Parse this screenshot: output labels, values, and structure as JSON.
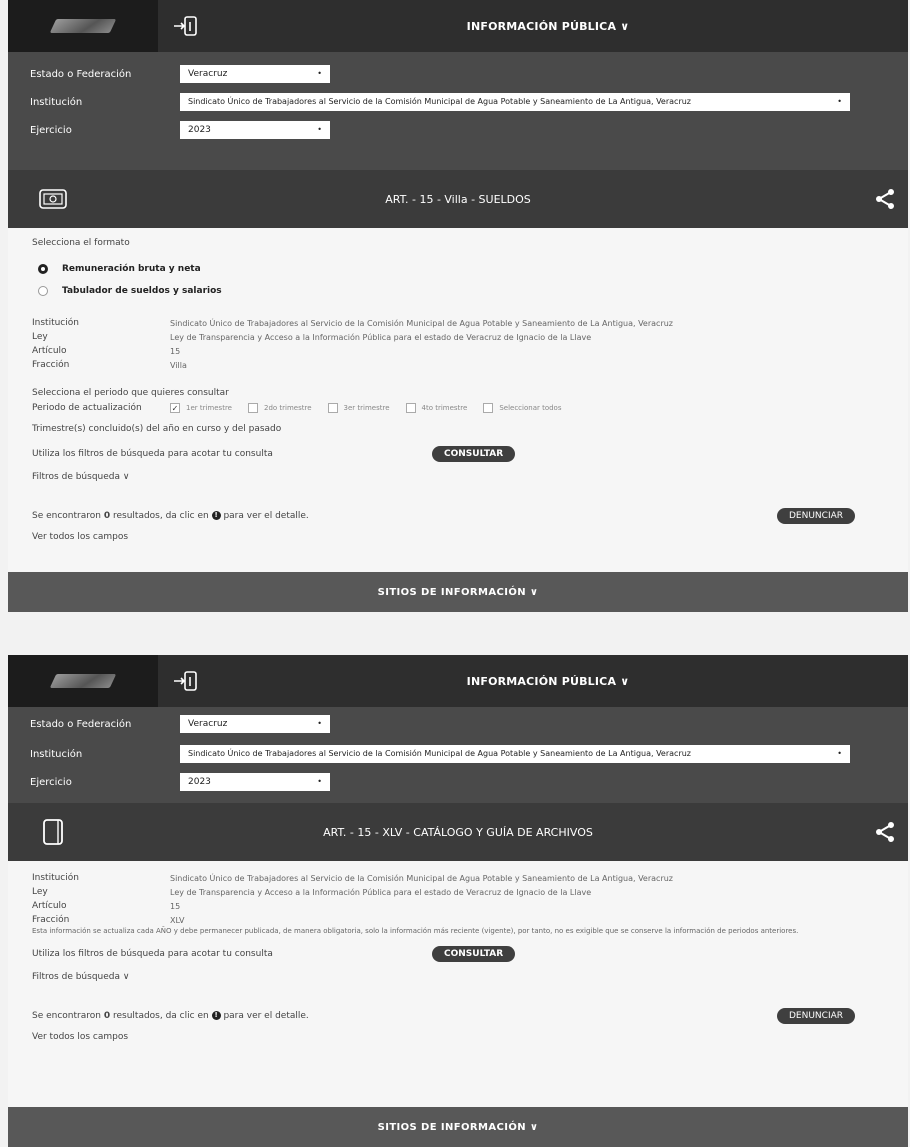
{
  "panel1": {
    "topbar_title": "INFORMACIÓN PÚBLICA ∨",
    "filters": {
      "estado_label": "Estado o Federación",
      "estado_value": "Veracruz",
      "institucion_label": "Institución",
      "institucion_value": "Sindicato Único de Trabajadores al Servicio de la Comisión Municipal de Agua Potable y Saneamiento de La Antigua, Veracruz",
      "ejercicio_label": "Ejercicio",
      "ejercicio_value": "2023"
    },
    "section_title": "ART. - 15 - Villa - SUELDOS",
    "format_label": "Selecciona el formato",
    "format_options": [
      "Remuneración bruta y neta",
      "Tabulador de sueldos y salarios"
    ],
    "details": {
      "institucion_k": "Institución",
      "institucion_v": "Sindicato Único de Trabajadores al Servicio de la Comisión Municipal de Agua Potable y Saneamiento de La Antigua, Veracruz",
      "ley_k": "Ley",
      "ley_v": "Ley de Transparencia y Acceso a la Información Pública para el estado de Veracruz de Ignacio de la Llave",
      "articulo_k": "Artículo",
      "articulo_v": "15",
      "fraccion_k": "Fracción",
      "fraccion_v": "Villa"
    },
    "period_prompt": "Selecciona el periodo que quieres consultar",
    "period_label": "Periodo de actualización",
    "period_options": [
      "1er trimestre",
      "2do trimestre",
      "3er trimestre",
      "4to trimestre",
      "Seleccionar todos"
    ],
    "trimestres_note": "Trimestre(s) concluido(s) del año en curso y del pasado",
    "filter_hint": "Utiliza los filtros de búsqueda para acotar tu consulta",
    "consultar": "CONSULTAR",
    "filtros_busqueda": "Filtros de búsqueda ∨",
    "results_text_a": "Se encontraron",
    "results_count": "0",
    "results_text_b": "resultados, da clic en",
    "results_text_c": "para ver el detalle.",
    "denunciar": "DENUNCIAR",
    "ver_todos": "Ver todos los campos",
    "footer": "SITIOS DE INFORMACIÓN ∨"
  },
  "panel2": {
    "topbar_title": "INFORMACIÓN PÚBLICA ∨",
    "filters": {
      "estado_label": "Estado o Federación",
      "estado_value": "Veracruz",
      "institucion_label": "Institución",
      "institucion_value": "Sindicato Único de Trabajadores al Servicio de la Comisión Municipal de Agua Potable y Saneamiento de La Antigua, Veracruz",
      "ejercicio_label": "Ejercicio",
      "ejercicio_value": "2023"
    },
    "section_title": "ART. - 15 - XLV - CATÁLOGO Y GUÍA DE ARCHIVOS",
    "details": {
      "institucion_k": "Institución",
      "institucion_v": "Sindicato Único de Trabajadores al Servicio de la Comisión Municipal de Agua Potable y Saneamiento de La Antigua, Veracruz",
      "ley_k": "Ley",
      "ley_v": "Ley de Transparencia y Acceso a la Información Pública para el estado de Veracruz de Ignacio de la Llave",
      "articulo_k": "Artículo",
      "articulo_v": "15",
      "fraccion_k": "Fracción",
      "fraccion_v": "XLV"
    },
    "note": "Esta información se actualiza cada AÑO y debe permanecer publicada, de manera obligatoria, solo la información más reciente (vigente), por tanto, no es exigible que se conserve la información de periodos anteriores.",
    "filter_hint": "Utiliza los filtros de búsqueda para acotar tu consulta",
    "consultar": "CONSULTAR",
    "filtros_busqueda": "Filtros de búsqueda ∨",
    "results_text_a": "Se encontraron",
    "results_count": "0",
    "results_text_b": "resultados, da clic en",
    "results_text_c": "para ver el detalle.",
    "denunciar": "DENUNCIAR",
    "ver_todos": "Ver todos los campos",
    "footer": "SITIOS DE INFORMACIÓN ∨"
  },
  "icons": {
    "info": "!"
  }
}
